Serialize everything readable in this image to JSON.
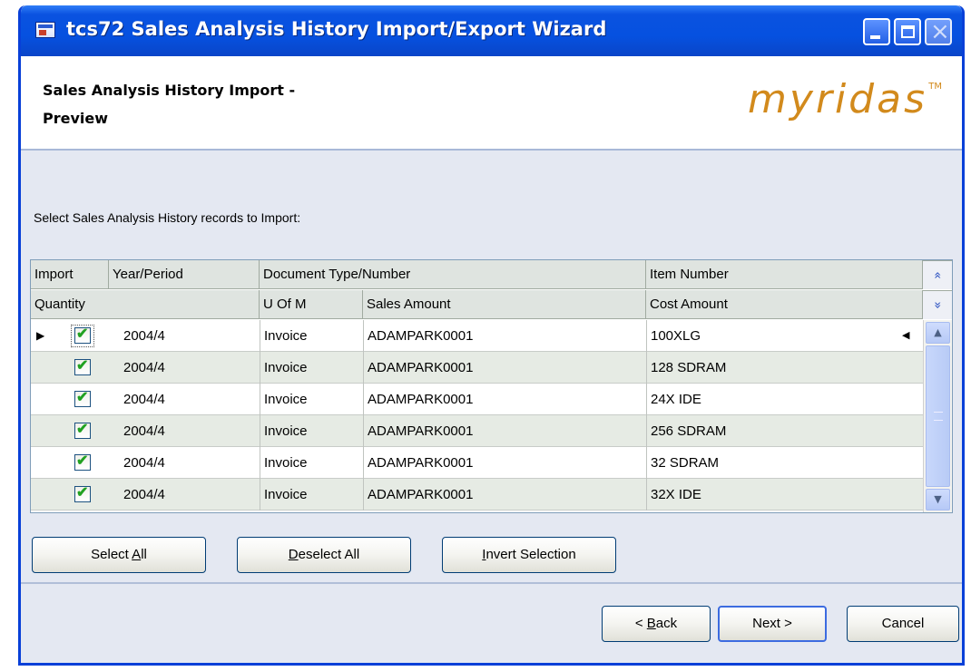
{
  "window": {
    "title": "tcs72 Sales Analysis History Import/Export Wizard"
  },
  "header": {
    "title_line1": "Sales Analysis History Import -",
    "title_line2": "Preview",
    "logo_text": "myridas",
    "logo_tm": "TM"
  },
  "instruction": "Select Sales Analysis History records to Import:",
  "grid": {
    "header_row1": [
      "Import",
      "Year/Period",
      "Document Type/Number",
      "Item Number"
    ],
    "header_row2": [
      "Quantity",
      "U Of M",
      "Sales Amount",
      "Cost Amount"
    ],
    "rows": [
      {
        "checked": true,
        "period": "2004/4",
        "doc_type": "Invoice",
        "doc_number": "ADAMPARK0001",
        "item": "100XLG",
        "current": true
      },
      {
        "checked": true,
        "period": "2004/4",
        "doc_type": "Invoice",
        "doc_number": "ADAMPARK0001",
        "item": "128 SDRAM"
      },
      {
        "checked": true,
        "period": "2004/4",
        "doc_type": "Invoice",
        "doc_number": "ADAMPARK0001",
        "item": "24X IDE"
      },
      {
        "checked": true,
        "period": "2004/4",
        "doc_type": "Invoice",
        "doc_number": "ADAMPARK0001",
        "item": "256 SDRAM"
      },
      {
        "checked": true,
        "period": "2004/4",
        "doc_type": "Invoice",
        "doc_number": "ADAMPARK0001",
        "item": "32 SDRAM"
      },
      {
        "checked": true,
        "period": "2004/4",
        "doc_type": "Invoice",
        "doc_number": "ADAMPARK0001",
        "item": "32X IDE"
      }
    ]
  },
  "selection_buttons": {
    "select_all": {
      "pre": "Select ",
      "key": "A",
      "post": "ll"
    },
    "deselect_all": {
      "pre": "",
      "key": "D",
      "post": "eselect All"
    },
    "invert_selection": {
      "pre": "",
      "key": "I",
      "post": "nvert Selection"
    }
  },
  "nav_buttons": {
    "back": {
      "pre": "< ",
      "key": "B",
      "post": "ack"
    },
    "next": "Next >",
    "cancel": "Cancel"
  },
  "icons": {
    "row_indicator": "▶",
    "row_marker": "◀",
    "check": "✔",
    "expand_up": "«",
    "expand_down": "»"
  }
}
